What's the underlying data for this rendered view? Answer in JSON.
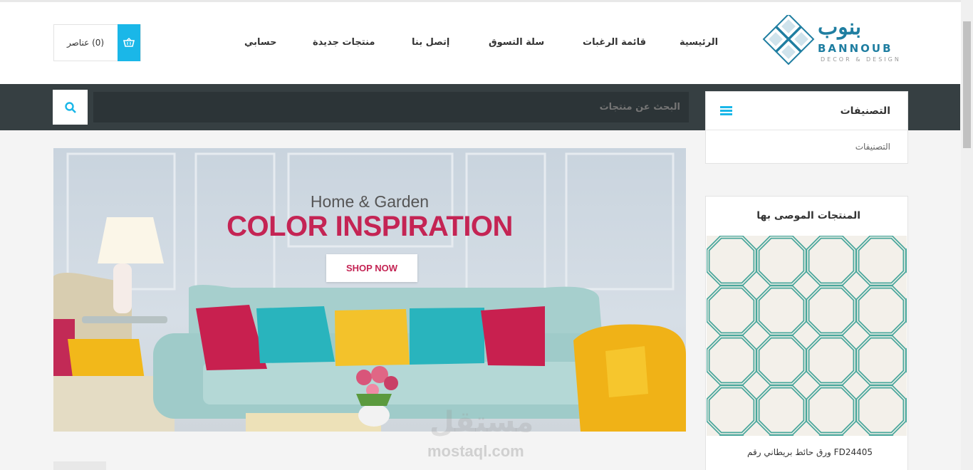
{
  "header": {
    "logo": {
      "arabic": "بنوب",
      "english": "BANNOUB",
      "tagline": "DECOR & DESIGN"
    },
    "nav": [
      {
        "label": "الرئيسية"
      },
      {
        "label": "قائمة الرغبات"
      },
      {
        "label": "سلة التسوق"
      },
      {
        "label": "إتصل بنا"
      },
      {
        "label": "منتجات جديدة"
      },
      {
        "label": "حسابي"
      }
    ],
    "cart": {
      "label": "(0) عناصر",
      "icon": "basket-icon"
    }
  },
  "search": {
    "placeholder": "البحث عن منتجات",
    "icon": "search-icon"
  },
  "sidebar": {
    "categories": {
      "title": "التصنيفات",
      "icon": "menu-icon",
      "items": [
        "التصنيفات"
      ]
    },
    "recommended": {
      "title": "المنتجات الموصى بها",
      "product_name": "ورق حائط بريطاني رقم FD24405"
    }
  },
  "banner": {
    "subtitle": "Home & Garden",
    "title": "COLOR INSPIRATION",
    "button": "SHOP NOW"
  },
  "watermark": {
    "arabic": "مستقل",
    "english": "mostaql.com"
  },
  "colors": {
    "accent": "#1ab7e8",
    "banner_title": "#c42454",
    "search_bar": "#363f42",
    "logo": "#1f7ea1"
  }
}
